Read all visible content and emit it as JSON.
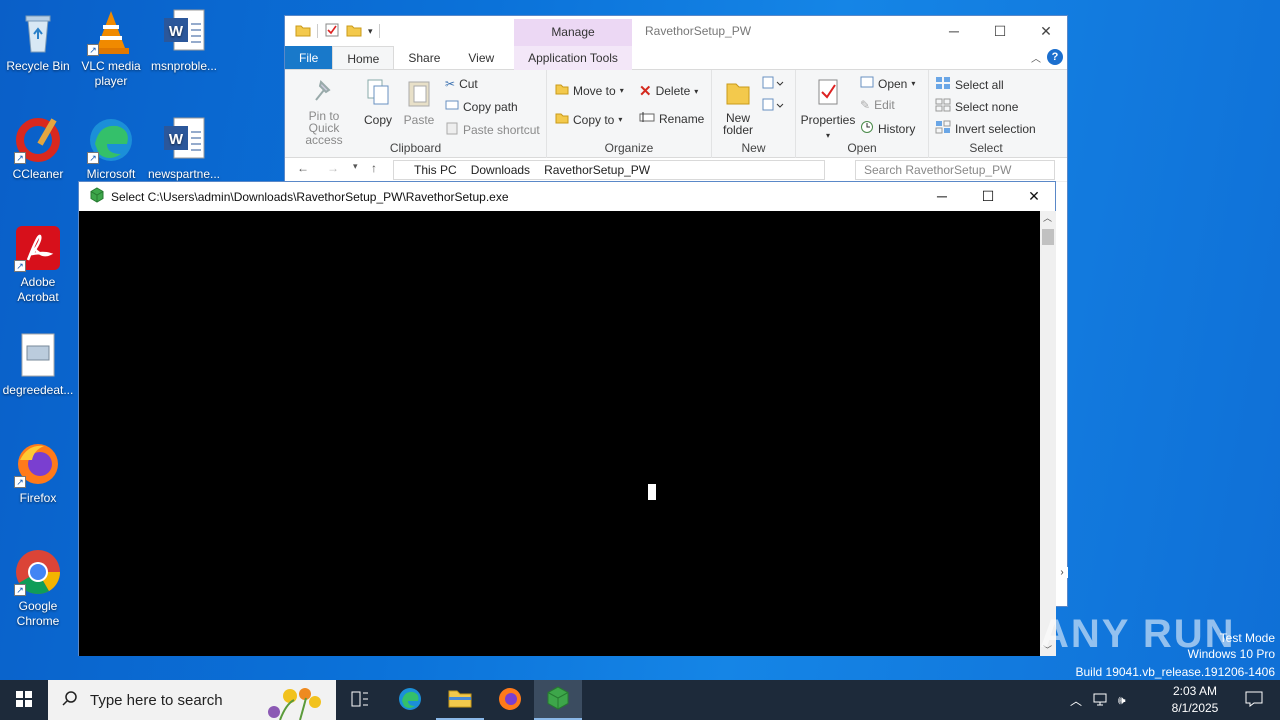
{
  "desktop": {
    "icons": [
      {
        "label": "Recycle Bin",
        "icon": "recycle-bin-icon"
      },
      {
        "label": "VLC media player",
        "icon": "vlc-icon"
      },
      {
        "label": "msnproble...",
        "icon": "word-doc-icon"
      },
      {
        "label": "CCleaner",
        "icon": "ccleaner-icon"
      },
      {
        "label": "Microsoft",
        "icon": "edge-icon"
      },
      {
        "label": "newspartne...",
        "icon": "word-doc-icon"
      },
      {
        "label": "Adobe Acrobat",
        "icon": "acrobat-icon"
      },
      {
        "label": "degreedeat...",
        "icon": "image-file-icon"
      },
      {
        "label": "Firefox",
        "icon": "firefox-icon"
      },
      {
        "label": "Google Chrome",
        "icon": "chrome-icon"
      }
    ]
  },
  "explorer": {
    "title": "RavethorSetup_PW",
    "manage_tab": "Manage",
    "tabs": [
      "File",
      "Home",
      "Share",
      "View",
      "Application Tools"
    ],
    "clipboard": {
      "pin": "Pin to Quick access",
      "copy": "Copy",
      "paste": "Paste",
      "cut": "Cut",
      "copy_path": "Copy path",
      "paste_shortcut": "Paste shortcut",
      "label": "Clipboard"
    },
    "organize": {
      "move_to": "Move to",
      "copy_to": "Copy to",
      "delete": "Delete",
      "rename": "Rename",
      "label": "Organize"
    },
    "new": {
      "new_folder": "New folder",
      "label": "New"
    },
    "open": {
      "properties": "Properties",
      "open": "Open",
      "edit": "Edit",
      "history": "History",
      "label": "Open"
    },
    "select": {
      "select_all": "Select all",
      "select_none": "Select none",
      "invert": "Invert selection",
      "label": "Select"
    },
    "address": {
      "crumbs": [
        "This PC",
        "Downloads",
        "RavethorSetup_PW"
      ],
      "search_placeholder": "Search RavethorSetup_PW"
    }
  },
  "console": {
    "title": "Select C:\\Users\\admin\\Downloads\\RavethorSetup_PW\\RavethorSetup.exe"
  },
  "taskbar": {
    "search_placeholder": "Type here to search",
    "time": "2:03 AM",
    "date": "8/1/2025"
  },
  "watermark": {
    "brand": "ANY RUN",
    "line1": "Test Mode",
    "line2": "Windows 10 Pro",
    "line3": "Build 19041.vb_release.191206-1406"
  },
  "colors": {
    "accent": "#1979ca",
    "desktop": "#0b72d9",
    "taskbar": "#1d2a3a",
    "manage": "#ecd8f4"
  }
}
